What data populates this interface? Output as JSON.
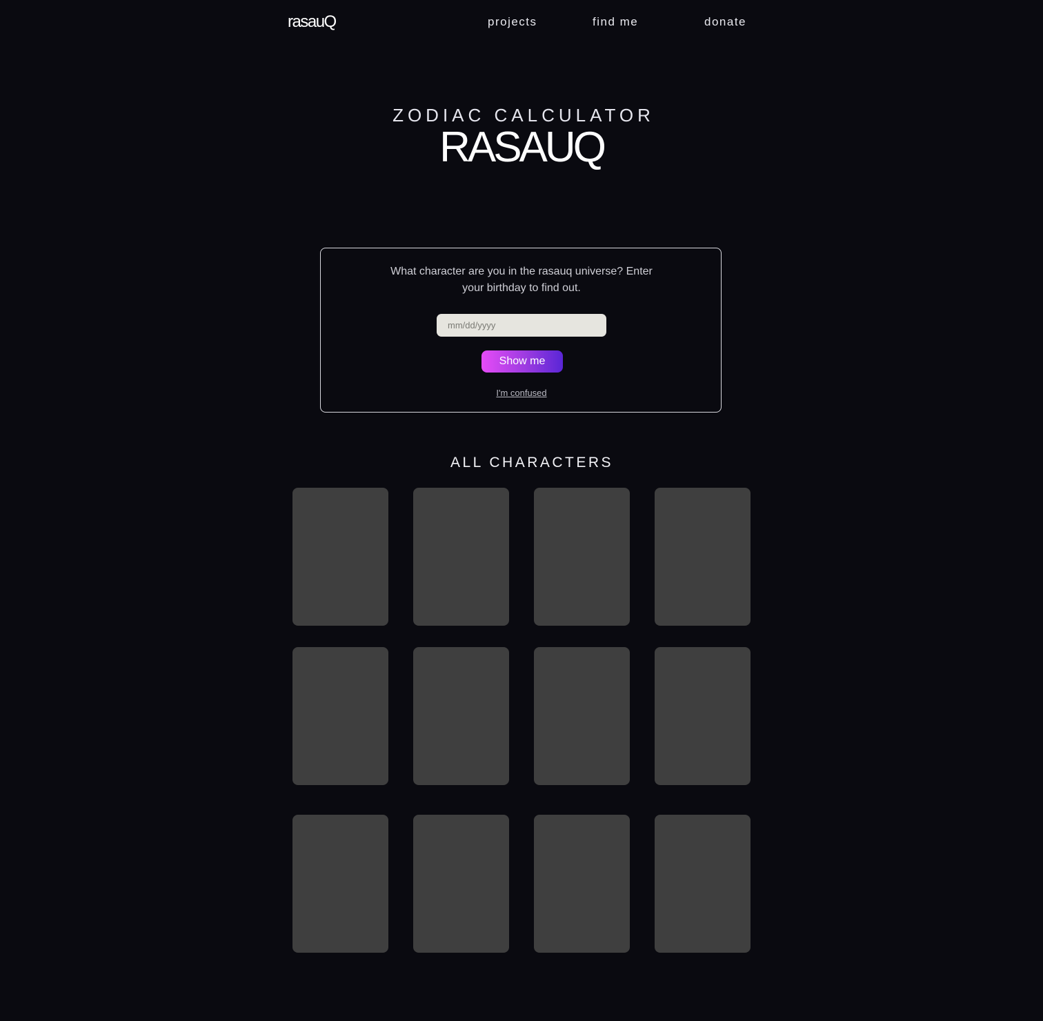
{
  "header": {
    "logo": "rasauQ",
    "nav": [
      "projects",
      "find me",
      "donate"
    ]
  },
  "hero": {
    "subtitle": "ZODIAC CALCULATOR",
    "title": "RASAUQ"
  },
  "calculator": {
    "prompt": "What character are you in the rasauq universe? Enter your birthday to find out.",
    "date_placeholder": "mm/dd/yyyy",
    "date_value": "",
    "submit_label": "Show me",
    "help_link": "I'm confused",
    "button_gradient": [
      "#e64cf7",
      "#5a26d6"
    ]
  },
  "characters": {
    "heading": "ALL CHARACTERS",
    "card_count": 12,
    "card_color": "#3f3f3f"
  },
  "colors": {
    "background": "#0a0a10",
    "text": "#ffffff"
  }
}
